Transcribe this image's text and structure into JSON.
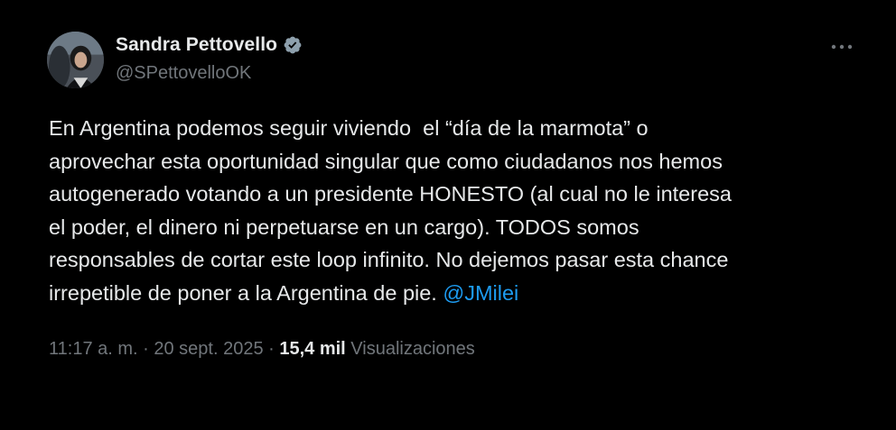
{
  "author": {
    "name": "Sandra Pettovello",
    "handle": "@SPettovelloOK",
    "verified_color": "#8ea0ad"
  },
  "tweet": {
    "lines": [
      "En Argentina podemos seguir viviendo  el “día de la marmota” o",
      "aprovechar esta oportunidad singular que como ciudadanos nos hemos",
      "autogenerado votando a un presidente HONESTO (al cual no le interesa",
      "el poder, el dinero ni perpetuarse en un cargo). TODOS somos",
      "responsables de cortar este loop infinito. No dejemos pasar esta chance",
      "irrepetible de poner a la Argentina de pie. "
    ],
    "mention": "@JMilei"
  },
  "meta": {
    "time": "11:17 a. m.",
    "sep1": " · ",
    "date": "20 sept. 2025",
    "sep2": " · ",
    "views_count": "15,4 mil",
    "views_label": " Visualizaciones"
  },
  "icons": {
    "more": "more-options-icon",
    "verified": "verified-badge-icon"
  },
  "colors": {
    "background": "#000000",
    "text": "#e7e9ea",
    "secondary": "#71767b",
    "link": "#1d9bf0"
  }
}
